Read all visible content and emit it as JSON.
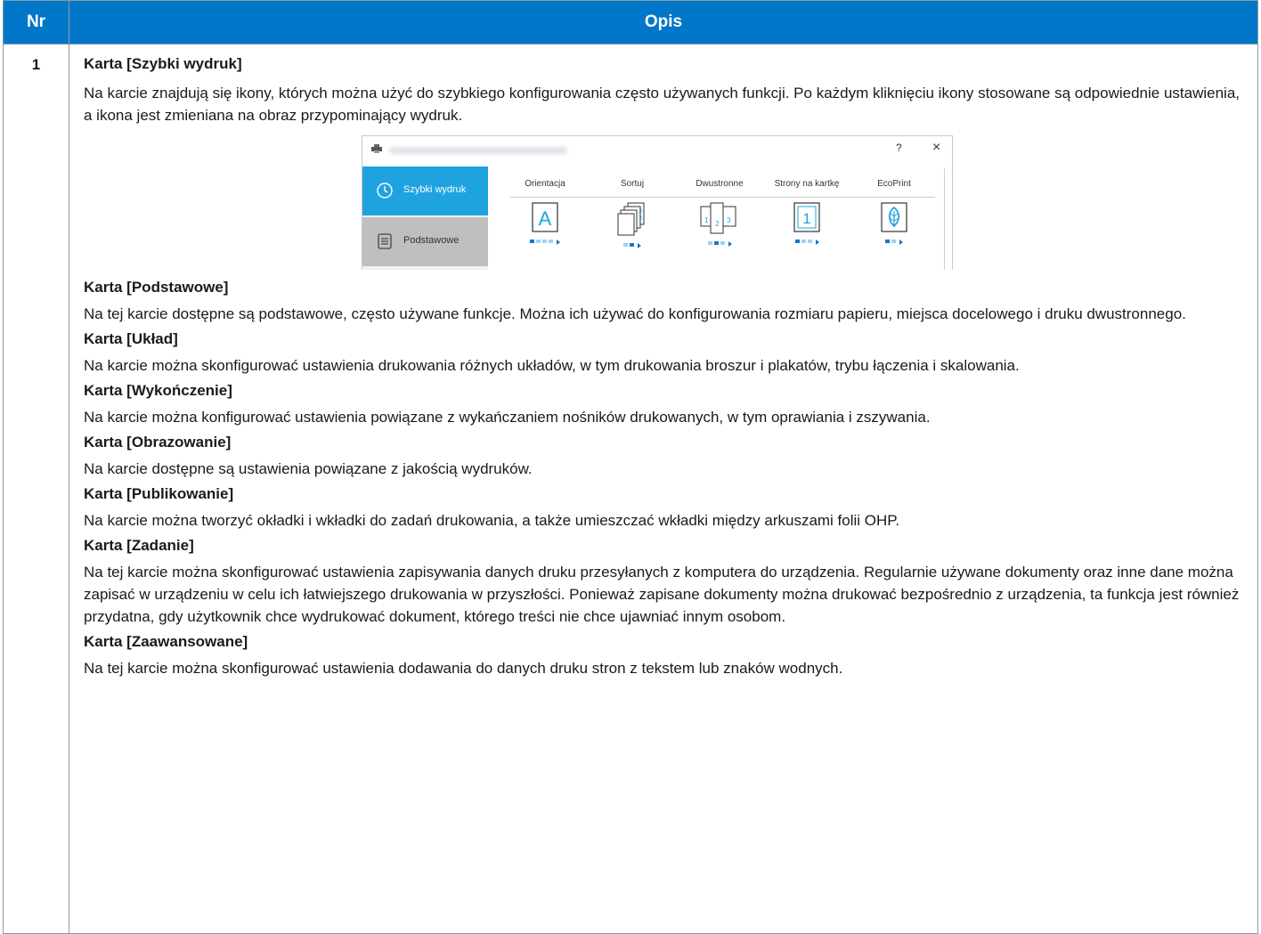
{
  "table": {
    "header_nr": "Nr",
    "header_opis": "Opis",
    "row_number": "1"
  },
  "sections": [
    {
      "title": "Karta [Szybki wydruk]",
      "body": "Na karcie znajdują się ikony, których można użyć do szybkiego konfigurowania często używanych funkcji. Po każdym kliknięciu ikony stosowane są odpowiednie ustawienia, a ikona jest zmieniana na obraz przypominający wydruk."
    },
    {
      "title": "Karta [Podstawowe]",
      "body": "Na tej karcie dostępne są podstawowe, często używane funkcje. Można ich używać do konfigurowania rozmiaru papieru, miejsca docelowego i druku dwustronnego."
    },
    {
      "title": "Karta [Układ]",
      "body": "Na karcie można skonfigurować ustawienia drukowania różnych układów, w tym drukowania broszur i plakatów, trybu łączenia i skalowania."
    },
    {
      "title": "Karta [Wykończenie]",
      "body": "Na karcie można konfigurować ustawienia powiązane z wykańczaniem nośników drukowanych, w tym oprawiania i zszywania."
    },
    {
      "title": "Karta [Obrazowanie]",
      "body": "Na karcie dostępne są ustawienia powiązane z jakością wydruków."
    },
    {
      "title": "Karta [Publikowanie]",
      "body": "Na karcie można tworzyć okładki i wkładki do zadań drukowania, a także umieszczać wkładki między arkuszami folii OHP."
    },
    {
      "title": "Karta [Zadanie]",
      "body": "Na tej karcie można skonfigurować ustawienia zapisywania danych druku przesyłanych z komputera do urządzenia. Regularnie używane dokumenty oraz inne dane można zapisać w urządzeniu w celu ich łatwiejszego drukowania w przyszłości. Ponieważ zapisane dokumenty można drukować bezpośrednio z urządzenia, ta funkcja jest również przydatna, gdy użytkownik chce wydrukować dokument, którego treści nie chce ujawniać innym osobom."
    },
    {
      "title": "Karta [Zaawansowane]",
      "body": "Na tej karcie można skonfigurować ustawienia dodawania do danych druku stron z tekstem lub znaków wodnych."
    }
  ],
  "dialog": {
    "help": "?",
    "close": "×",
    "tabs": [
      "Szybki wydruk",
      "Podstawowe"
    ],
    "columns": [
      {
        "label": "Orientacja",
        "icon": "orientation-icon",
        "icon_text": "A"
      },
      {
        "label": "Sortuj",
        "icon": "collate-icon"
      },
      {
        "label": "Dwustronne",
        "icon": "duplex-icon"
      },
      {
        "label": "Strony na kartkę",
        "icon": "pages-per-sheet-icon",
        "icon_text": "1"
      },
      {
        "label": "EcoPrint",
        "icon": "ecoprint-icon"
      }
    ],
    "accent": "#1fa3de"
  },
  "colors": {
    "header_bg": "#0077c8",
    "header_text": "#ffffff"
  }
}
